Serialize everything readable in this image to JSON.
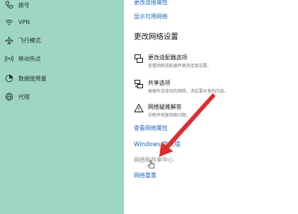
{
  "colors": {
    "sidebar_bg": "#9fd6c3",
    "link": "#1a64c8",
    "arrow": "#e22b2b"
  },
  "sidebar": {
    "items": [
      {
        "label": "拨号",
        "icon": "phone-icon"
      },
      {
        "label": "VPN",
        "icon": "vpn-icon"
      },
      {
        "label": "飞行模式",
        "icon": "airplane-icon"
      },
      {
        "label": "移动热点",
        "icon": "hotspot-icon"
      },
      {
        "label": "数据使用量",
        "icon": "data-usage-icon"
      },
      {
        "label": "代理",
        "icon": "globe-icon"
      }
    ]
  },
  "main": {
    "top_links": [
      "更改连接属性",
      "显示可用网络"
    ],
    "section_title": "更改网络设置",
    "options": [
      {
        "title": "更改适配器选项",
        "desc": "查看网络适配器并更改连接设置。",
        "icon": "adapter-icon"
      },
      {
        "title": "共享选项",
        "desc": "根据所连接到的网络，决定要共享的内容。",
        "icon": "sharing-icon"
      },
      {
        "title": "网络疑难解答",
        "desc": "诊断并修复网络问题。",
        "icon": "warning-icon"
      }
    ],
    "links": {
      "view_properties": "查看网络属性",
      "firewall": "Windows 防火墙",
      "sharing_center": "网络和共享中心",
      "reset": "网络重置"
    }
  }
}
